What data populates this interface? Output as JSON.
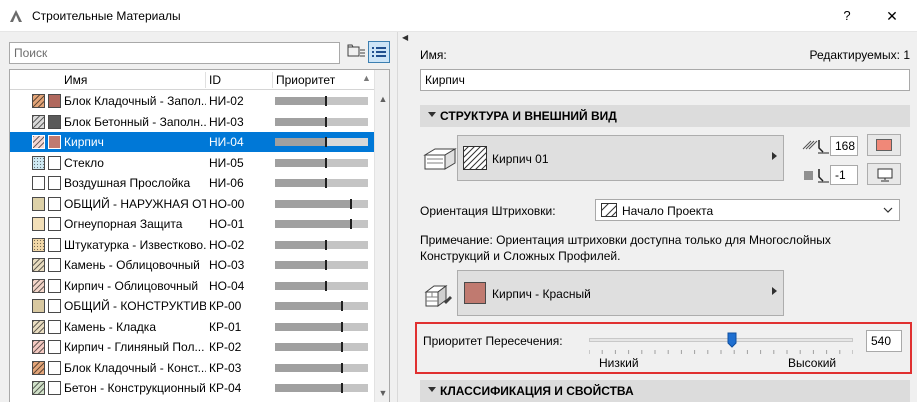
{
  "window": {
    "title": "Строительные Материалы",
    "help_label": "?",
    "close_label": "✕"
  },
  "list": {
    "search_placeholder": "Поиск",
    "columns": {
      "name": "Имя",
      "id": "ID",
      "priority": "Приоритет"
    },
    "rows": [
      {
        "name": "Блок Кладочный - Запол...",
        "id": "НИ-02",
        "fill_color": "#e2a478",
        "hatch": "diagonal",
        "surface_color": "#b0685d",
        "priority": 0.55,
        "selected": false
      },
      {
        "name": "Блок Бетонный - Заполн...",
        "id": "НИ-03",
        "fill_color": "#d9d9d9",
        "hatch": "diagonal",
        "surface_color": "#5a5a5a",
        "priority": 0.55,
        "selected": false
      },
      {
        "name": "Кирпич",
        "id": "НИ-04",
        "fill_color": "#f4d7d3",
        "hatch": "diagonal",
        "surface_color": "#c07a70",
        "priority": 0.55,
        "selected": true
      },
      {
        "name": "Стекло",
        "id": "НИ-05",
        "fill_color": "#cfeaf4",
        "hatch": "dots",
        "surface_color": "#ffffff",
        "priority": 0.55,
        "selected": false
      },
      {
        "name": "Воздушная Прослойка",
        "id": "НИ-06",
        "fill_color": "#ffffff",
        "hatch": "none",
        "surface_color": "#ffffff",
        "priority": 0.55,
        "selected": false
      },
      {
        "name": "ОБЩИЙ - НАРУЖНАЯ ОТ...",
        "id": "НО-00",
        "fill_color": "#ddd1a8",
        "hatch": "none",
        "surface_color": "#ffffff",
        "priority": 0.82,
        "selected": false
      },
      {
        "name": "Огнеупорная Защита",
        "id": "НО-01",
        "fill_color": "#f2dfb8",
        "hatch": "none",
        "surface_color": "#ffffff",
        "priority": 0.82,
        "selected": false
      },
      {
        "name": "Штукатурка - Известково...",
        "id": "НО-02",
        "fill_color": "#f2d8a8",
        "hatch": "dots",
        "surface_color": "#ffffff",
        "priority": 0.55,
        "selected": false
      },
      {
        "name": "Камень - Облицовочный",
        "id": "НО-03",
        "fill_color": "#e8dcc0",
        "hatch": "diagonal",
        "surface_color": "#ffffff",
        "priority": 0.55,
        "selected": false
      },
      {
        "name": "Кирпич - Облицовочный",
        "id": "НО-04",
        "fill_color": "#f2d4c8",
        "hatch": "diagonal",
        "surface_color": "#ffffff",
        "priority": 0.55,
        "selected": false
      },
      {
        "name": "ОБЩИЙ - КОНСТРУКТИВ...",
        "id": "КР-00",
        "fill_color": "#d8c8a0",
        "hatch": "none",
        "surface_color": "#ffffff",
        "priority": 0.72,
        "selected": false
      },
      {
        "name": "Камень - Кладка",
        "id": "КР-01",
        "fill_color": "#e8dcc0",
        "hatch": "diagonal",
        "surface_color": "#ffffff",
        "priority": 0.72,
        "selected": false
      },
      {
        "name": "Кирпич - Глиняный Пол...",
        "id": "КР-02",
        "fill_color": "#f2c8c0",
        "hatch": "diagonal",
        "surface_color": "#ffffff",
        "priority": 0.72,
        "selected": false
      },
      {
        "name": "Блок Кладочный - Конст...",
        "id": "КР-03",
        "fill_color": "#e2a478",
        "hatch": "diagonal",
        "surface_color": "#ffffff",
        "priority": 0.72,
        "selected": false
      },
      {
        "name": "Бетон - Конструкционный",
        "id": "КР-04",
        "fill_color": "#d0e0c8",
        "hatch": "diagonal",
        "surface_color": "#ffffff",
        "priority": 0.72,
        "selected": false
      }
    ]
  },
  "details": {
    "name_label": "Имя:",
    "editable_label": "Редактируемых: 1",
    "name_value": "Кирпич",
    "section_structure": "СТРУКТУРА И ВНЕШНИЙ ВИД",
    "hatch_name": "Кирпич 01",
    "pen_value": "168",
    "pen_color": "#f08878",
    "bg_pen_value": "-1",
    "hatch_orientation_label": "Ориентация Штриховки:",
    "hatch_orientation_value": "Начало Проекта",
    "note_text": "Примечание: Ориентация штриховки доступна только для Многослойных Конструкций и Сложных Профилей.",
    "surface_name": "Кирпич - Красный",
    "surface_color": "#c07a70",
    "intersection_label": "Приоритет Пересечения:",
    "intersection_value": "540",
    "intersection_level": 0.54,
    "low_label": "Низкий",
    "high_label": "Высокий",
    "section_classification": "КЛАССИФИКАЦИЯ И СВОЙСТВА"
  }
}
